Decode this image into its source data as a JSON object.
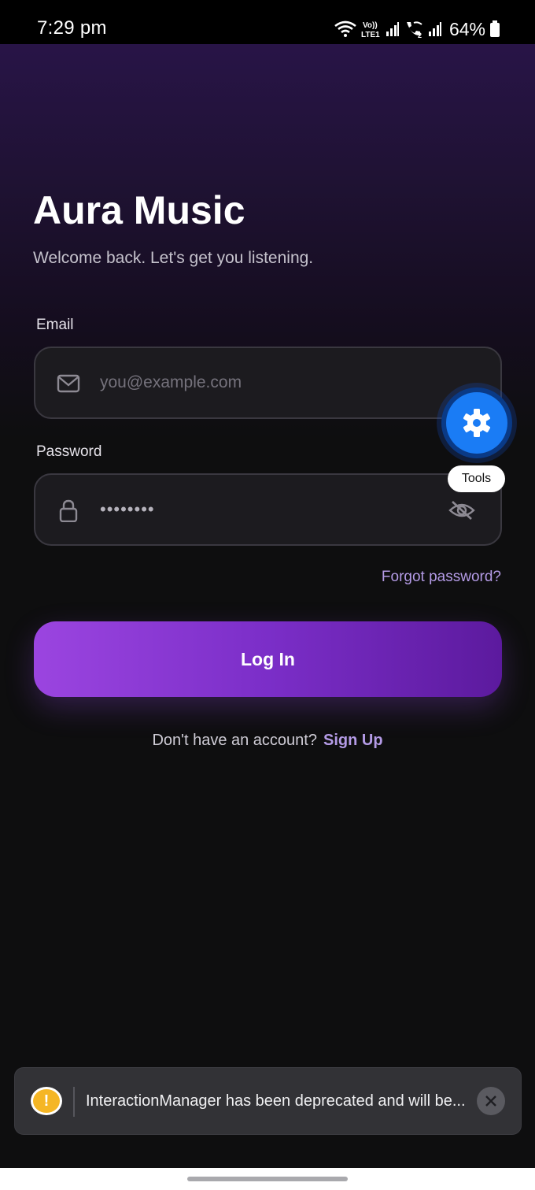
{
  "status_bar": {
    "time": "7:29 pm",
    "battery": "64%",
    "icons": [
      "wifi-icon",
      "volte-lte1-icon",
      "signal-icon",
      "wifi-calling-icon",
      "signal-icon",
      "battery-icon"
    ]
  },
  "header": {
    "title": "Aura Music",
    "subtitle": "Welcome back. Let's get you listening."
  },
  "form": {
    "email_label": "Email",
    "email_placeholder": "you@example.com",
    "password_label": "Password",
    "password_value": "••••••••",
    "forgot_password": "Forgot password?",
    "login_button": "Log In",
    "signup_prompt": "Don't have an account?",
    "signup_link": "Sign Up"
  },
  "tools": {
    "tooltip": "Tools"
  },
  "toast": {
    "icon": "!",
    "message": "InteractionManager has been deprecated and will be..."
  },
  "colors": {
    "accent": "#b49be6",
    "button_gradient_start": "#9b45e0",
    "button_gradient_end": "#5c1a9e",
    "tools_fab": "#1a7cf5",
    "warning": "#f5b625",
    "background": "#0e0e0f"
  }
}
